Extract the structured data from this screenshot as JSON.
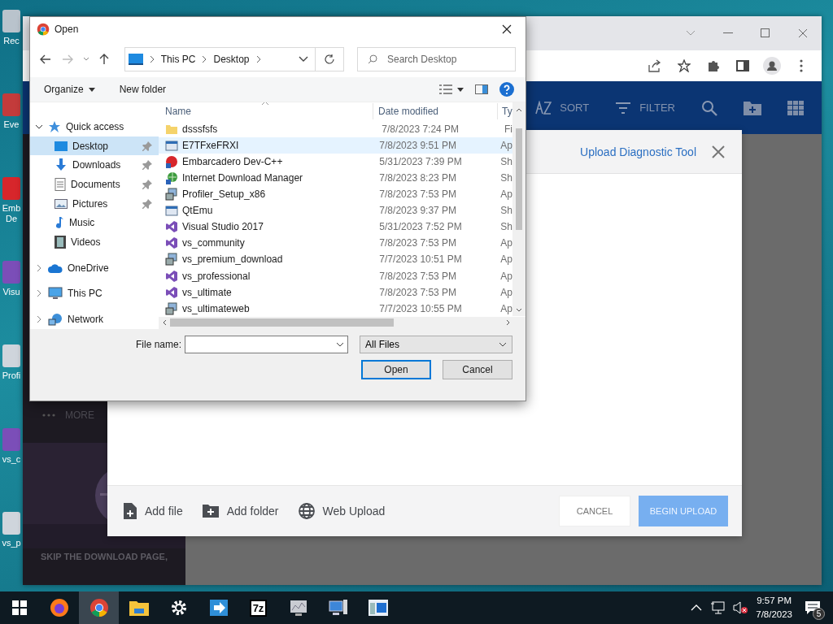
{
  "desktop_icons": [
    {
      "label": "Rec",
      "kind": "bin"
    },
    {
      "label": "Eve",
      "kind": "shortcut"
    },
    {
      "label": "Emb De",
      "kind": "dev"
    },
    {
      "label": "Visu",
      "kind": "vs"
    },
    {
      "label": "Profi",
      "kind": "setup"
    },
    {
      "label": "vs_c",
      "kind": "vs"
    },
    {
      "label": "vs_p",
      "kind": "setup"
    }
  ],
  "browser": {
    "toolbar": [
      {
        "label": "SORT",
        "kind": "sort"
      },
      {
        "label": "FILTER",
        "kind": "filter"
      },
      {
        "kind": "search"
      },
      {
        "kind": "new-folder"
      },
      {
        "kind": "grid"
      }
    ],
    "sidebar": {
      "more": "MORE",
      "promo": "SKIP THE DOWNLOAD PAGE,"
    }
  },
  "upload_modal": {
    "title": "Upload Diagnostic Tool",
    "actions": [
      {
        "label": "Add file",
        "kind": "file"
      },
      {
        "label": "Add folder",
        "kind": "folder"
      },
      {
        "label": "Web Upload",
        "kind": "web"
      }
    ],
    "buttons": [
      {
        "label": "CANCEL",
        "kind": "secondary"
      },
      {
        "label": "BEGIN UPLOAD",
        "kind": "primary",
        "disabled": true
      }
    ]
  },
  "open_dialog": {
    "title": "Open",
    "path": [
      "This PC",
      "Desktop"
    ],
    "search": {
      "placeholder": "Search Desktop"
    },
    "toolbar": [
      "Organize",
      "New folder"
    ],
    "nav": [
      {
        "label": "Quick access",
        "kind": "star",
        "expanded": true,
        "children": [
          {
            "label": "Desktop",
            "kind": "desktop",
            "selected": true,
            "pinned": true
          },
          {
            "label": "Downloads",
            "kind": "download",
            "selected": false,
            "pinned": true
          },
          {
            "label": "Documents",
            "kind": "document",
            "selected": false,
            "pinned": true
          },
          {
            "label": "Pictures",
            "kind": "picture-folder",
            "selected": false,
            "pinned": true
          },
          {
            "label": "Music",
            "kind": "music",
            "selected": false,
            "pinned": false
          },
          {
            "label": "Videos",
            "kind": "video",
            "selected": false,
            "pinned": false
          }
        ]
      },
      {
        "label": "OneDrive",
        "kind": "cloud",
        "expanded": false
      },
      {
        "label": "This PC",
        "kind": "pc",
        "expanded": false
      },
      {
        "label": "Network",
        "kind": "network",
        "expanded": false
      }
    ],
    "columns": [
      "Name",
      "Date modified",
      "Ty"
    ],
    "files": [
      {
        "name": "dsssfsfs",
        "date": "7/8/2023 7:24 PM",
        "type": "Fi",
        "kind": "folder",
        "selected": false
      },
      {
        "name": "E7TFxeFRXI",
        "date": "7/8/2023 9:51 PM",
        "type": "Ap",
        "kind": "app",
        "selected": true
      },
      {
        "name": "Embarcadero Dev-C++",
        "date": "5/31/2023 7:39 PM",
        "type": "Sh",
        "kind": "dev",
        "selected": false
      },
      {
        "name": "Internet Download Manager",
        "date": "7/8/2023 8:23 PM",
        "type": "Sh",
        "kind": "globe",
        "selected": false
      },
      {
        "name": "Profiler_Setup_x86",
        "date": "7/8/2023 7:53 PM",
        "type": "Ap",
        "kind": "setup",
        "selected": false
      },
      {
        "name": "QtEmu",
        "date": "7/8/2023 9:37 PM",
        "type": "Sh",
        "kind": "app",
        "selected": false
      },
      {
        "name": "Visual Studio 2017",
        "date": "5/31/2023 7:52 PM",
        "type": "Sh",
        "kind": "vs",
        "selected": false
      },
      {
        "name": "vs_community",
        "date": "7/8/2023 7:53 PM",
        "type": "Ap",
        "kind": "vs",
        "selected": false
      },
      {
        "name": "vs_premium_download",
        "date": "7/7/2023 10:51 PM",
        "type": "Ap",
        "kind": "setup",
        "selected": false
      },
      {
        "name": "vs_professional",
        "date": "7/8/2023 7:53 PM",
        "type": "Ap",
        "kind": "vs",
        "selected": false
      },
      {
        "name": "vs_ultimate",
        "date": "7/8/2023 7:53 PM",
        "type": "Ap",
        "kind": "vs",
        "selected": false
      },
      {
        "name": "vs_ultimateweb",
        "date": "7/7/2023 10:55 PM",
        "type": "Ap",
        "kind": "setup",
        "selected": false
      }
    ],
    "file_name_label": "File name:",
    "file_type": "All Files",
    "buttons": [
      {
        "label": "Open",
        "default": true
      },
      {
        "label": "Cancel",
        "default": false
      }
    ]
  },
  "taskbar": {
    "apps": [
      {
        "kind": "start",
        "active": false
      },
      {
        "kind": "firefox",
        "active": false
      },
      {
        "kind": "chrome",
        "active": true
      },
      {
        "kind": "explorer",
        "active": false
      },
      {
        "kind": "settings",
        "active": false
      },
      {
        "kind": "arrow-app",
        "active": false
      },
      {
        "kind": "archive",
        "label": "7z",
        "active": false
      },
      {
        "kind": "monitor-app",
        "active": false
      },
      {
        "kind": "computer",
        "active": false
      },
      {
        "kind": "window-app",
        "active": false
      }
    ],
    "time": "9:57 PM",
    "date": "7/8/2023",
    "notifications": "5"
  }
}
